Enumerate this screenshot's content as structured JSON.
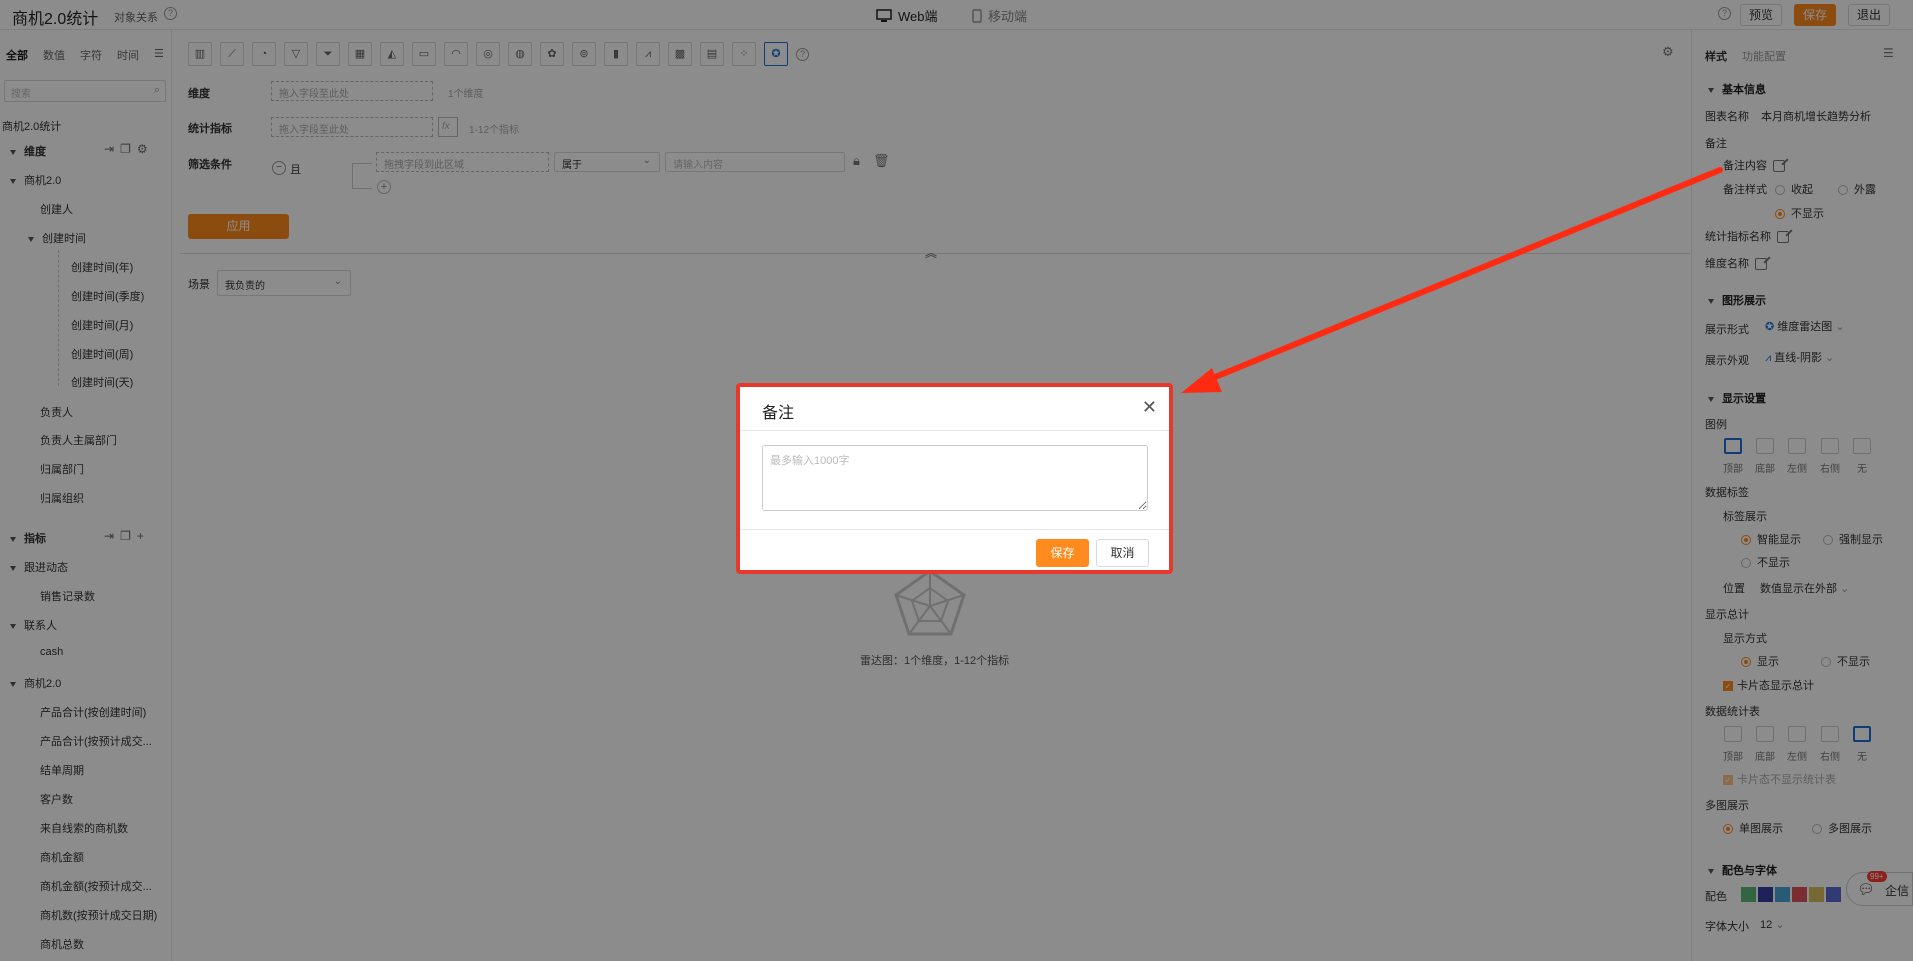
{
  "topbar": {
    "title": "商机2.0统计",
    "object_relation": "对象关系",
    "web_tab": "Web端",
    "mobile_tab": "移动端",
    "preview": "预览",
    "save": "保存",
    "exit": "退出"
  },
  "left": {
    "tabs": [
      "全部",
      "数值",
      "字符",
      "时间"
    ],
    "search_placeholder": "搜索",
    "root": "商机2.0统计",
    "dimension_title": "维度",
    "dimension_items": [
      "商机2.0",
      "创建人",
      "创建时间",
      "创建时间(年)",
      "创建时间(季度)",
      "创建时间(月)",
      "创建时间(周)",
      "创建时间(天)",
      "负责人",
      "负责人主属部门",
      "归属部门",
      "归属组织"
    ],
    "metric_title": "指标",
    "metric_items": [
      "跟进动态",
      "销售记录数",
      "联系人",
      "cash",
      "商机2.0",
      "产品合计(按创建时间)",
      "产品合计(按预计成交...",
      "结单周期",
      "客户数",
      "来自线索的商机数",
      "商机金额",
      "商机金额(按预计成交...",
      "商机数(按预计成交日期)",
      "商机总数"
    ]
  },
  "center": {
    "dimension_label": "维度",
    "dimension_placeholder": "拖入字段至此处",
    "dimension_hint": "1个维度",
    "metric_label": "统计指标",
    "metric_placeholder": "拖入字段至此处",
    "metric_hint": "1-12个指标",
    "fx": "fx",
    "filter_label": "筛选条件",
    "filter_and": "且",
    "filter_field_placeholder": "拖拽字段到此区域",
    "filter_operator": "属于",
    "filter_value_placeholder": "请输入内容",
    "apply_button": "应用",
    "scene_label": "场景",
    "scene_value": "我负责的",
    "chart_hint": "雷达图：1个维度，1-12个指标"
  },
  "right": {
    "tabs": [
      "样式",
      "功能配置"
    ],
    "basic_info": "基本信息",
    "chart_name_label": "图表名称",
    "chart_name_value": "本月商机增长趋势分析",
    "remark_label": "备注",
    "remark_content": "备注内容",
    "remark_style": "备注样式",
    "remark_collapse": "收起",
    "remark_expose": "外露",
    "remark_hide": "不显示",
    "metric_name": "统计指标名称",
    "dimension_name": "维度名称",
    "graph_section": "图形展示",
    "display_form_label": "展示形式",
    "display_form_value": "维度雷达图",
    "display_look_label": "展示外观",
    "display_look_value": "直线-阴影",
    "display_settings": "显示设置",
    "legend_label": "图例",
    "positions": [
      "顶部",
      "底部",
      "左侧",
      "右侧",
      "无"
    ],
    "data_label": "数据标签",
    "label_show": "标签展示",
    "smart_show": "智能显示",
    "force_show": "强制显示",
    "no_show": "不显示",
    "position_label": "位置",
    "position_value": "数值显示在外部",
    "total_label": "显示总计",
    "show_mode": "显示方式",
    "show": "显示",
    "hide": "不显示",
    "card_total": "卡片态显示总计",
    "stat_table": "数据统计表",
    "card_no_table": "卡片态不显示统计表",
    "multi_chart": "多图展示",
    "single_chart": "单图展示",
    "multi_chart_opt": "多图展示",
    "color_font": "配色与字体",
    "color_label": "配色",
    "font_size_label": "字体大小",
    "font_size_value": "12",
    "swatches": [
      "#5fb878",
      "#3a3fa0",
      "#4aa8d8",
      "#e0545c",
      "#d8c060",
      "#5a6ad0"
    ]
  },
  "chat": {
    "badge": "99+",
    "label": "企信"
  },
  "modal": {
    "title": "备注",
    "placeholder": "最多输入1000字",
    "save": "保存",
    "cancel": "取消"
  }
}
